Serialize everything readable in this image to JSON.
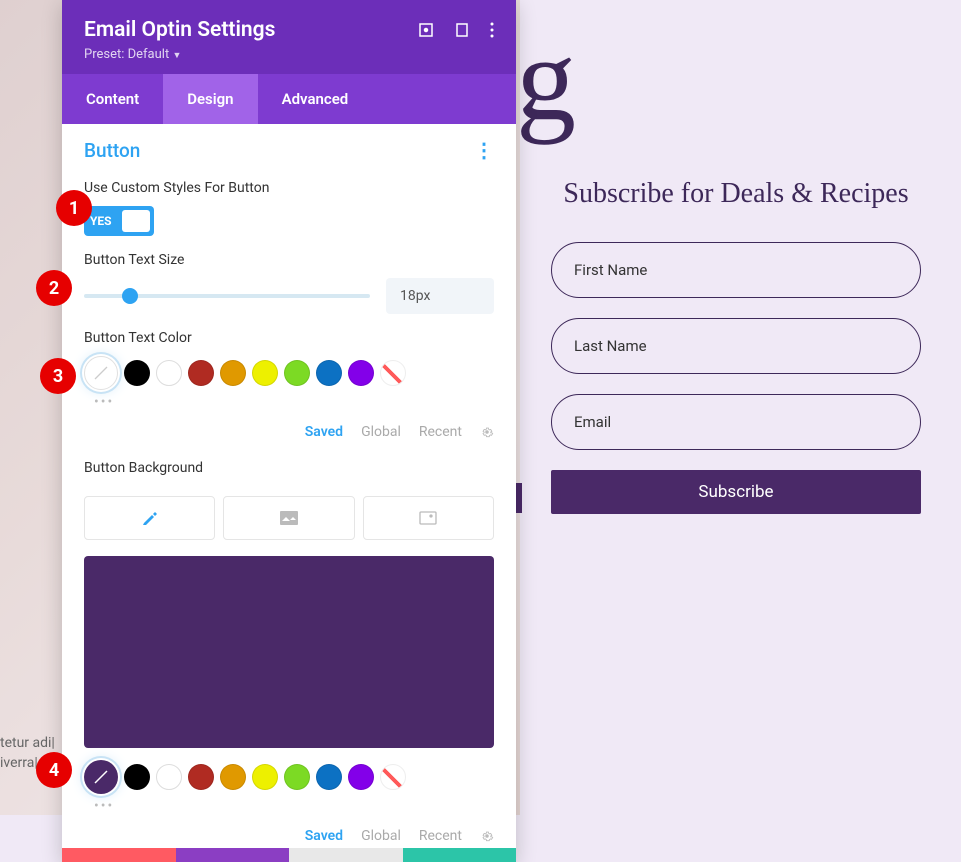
{
  "panel": {
    "title": "Email Optin Settings",
    "preset": "Preset: Default",
    "tabs": [
      "Content",
      "Design",
      "Advanced"
    ],
    "activeTab": 1
  },
  "section": {
    "title": "Button"
  },
  "fields": {
    "customStyles": {
      "label": "Use Custom Styles For Button",
      "value": "YES"
    },
    "textSize": {
      "label": "Button Text Size",
      "value": "18px"
    },
    "textColor": {
      "label": "Button Text Color",
      "colors": [
        "#ffffff",
        "#000000",
        "#ffffff",
        "#b02b22",
        "#e09900",
        "#edf000",
        "#7cda24",
        "#0c71c3",
        "#8300e9",
        "transparent"
      ],
      "selectedIndex": 0
    },
    "background": {
      "label": "Button Background",
      "previewColor": "#4a2968",
      "colors": [
        "#4a2968",
        "#000000",
        "#ffffff",
        "#b02b22",
        "#e09900",
        "#edf000",
        "#7cda24",
        "#0c71c3",
        "#8300e9",
        "transparent"
      ],
      "selectedIndex": 0
    }
  },
  "colorModes": {
    "saved": "Saved",
    "global": "Global",
    "recent": "Recent"
  },
  "subscribe": {
    "title": "Subscribe for Deals & Recipes",
    "firstName": "First Name",
    "lastName": "Last Name",
    "email": "Email",
    "button": "Subscribe"
  },
  "bgText": {
    "line1": "tetur adi|",
    "line2": "iverra|"
  },
  "annotations": [
    "1",
    "2",
    "3",
    "4"
  ],
  "bigLetter": "g"
}
